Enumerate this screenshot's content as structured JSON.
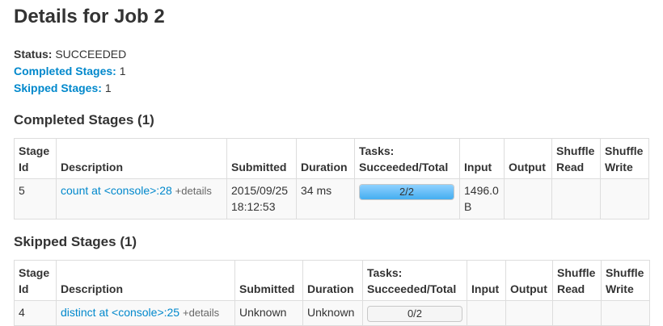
{
  "page": {
    "title": "Details for Job 2"
  },
  "summary": {
    "status_label": "Status:",
    "status_value": "SUCCEEDED",
    "completed_label": "Completed Stages:",
    "completed_value": "1",
    "skipped_label": "Skipped Stages:",
    "skipped_value": "1"
  },
  "completed": {
    "heading": "Completed Stages (1)",
    "headers": {
      "stage_id": "Stage Id",
      "description": "Description",
      "submitted": "Submitted",
      "duration": "Duration",
      "tasks": "Tasks: Succeeded/Total",
      "input": "Input",
      "output": "Output",
      "shuffle_read": "Shuffle Read",
      "shuffle_write": "Shuffle Write"
    },
    "rows": [
      {
        "stage_id": "5",
        "description": "count at <console>:28",
        "details": "+details",
        "submitted": "2015/09/25 18:12:53",
        "duration": "34 ms",
        "tasks": "2/2",
        "tasks_progress": 1.0,
        "input": "1496.0 B",
        "output": "",
        "shuffle_read": "",
        "shuffle_write": ""
      }
    ]
  },
  "skipped": {
    "heading": "Skipped Stages (1)",
    "headers": {
      "stage_id": "Stage Id",
      "description": "Description",
      "submitted": "Submitted",
      "duration": "Duration",
      "tasks": "Tasks: Succeeded/Total",
      "input": "Input",
      "output": "Output",
      "shuffle_read": "Shuffle Read",
      "shuffle_write": "Shuffle Write"
    },
    "rows": [
      {
        "stage_id": "4",
        "description": "distinct at <console>:25",
        "details": "+details",
        "submitted": "Unknown",
        "duration": "Unknown",
        "tasks": "0/2",
        "tasks_progress": 0.0,
        "input": "",
        "output": "",
        "shuffle_read": "",
        "shuffle_write": ""
      }
    ]
  },
  "colors": {
    "link": "#0088cc",
    "progress_fill": "#45aef0",
    "row_background": "#f9f9f9",
    "border": "#dddddd"
  }
}
